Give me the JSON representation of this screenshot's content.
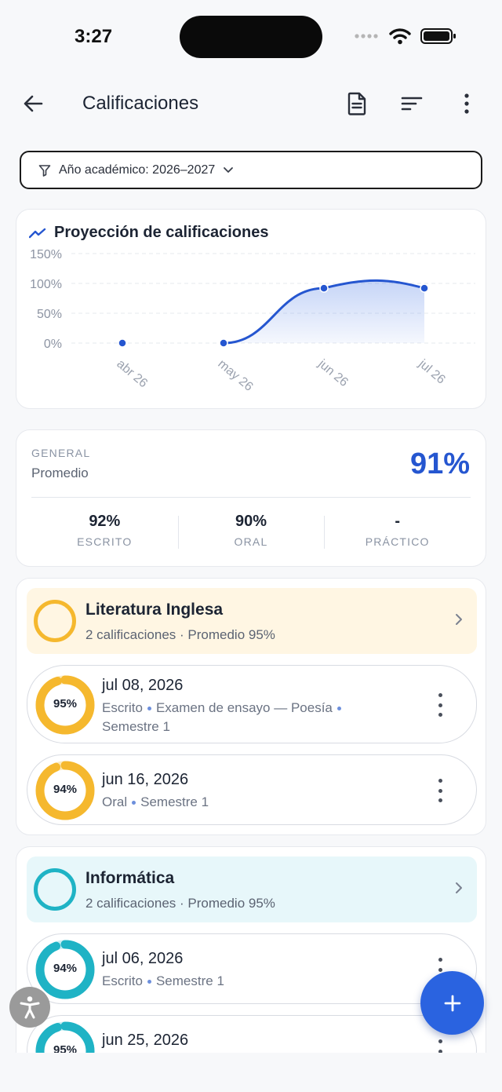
{
  "status": {
    "time": "3:27"
  },
  "app_bar": {
    "title": "Calificaciones"
  },
  "filter": {
    "label": "Año académico: 2026–2027"
  },
  "colors": {
    "accent": "#2556d0",
    "amber": "#f5b82e",
    "teal": "#1fb3c5"
  },
  "chart_data": {
    "type": "area",
    "title": "Proyección de calificaciones",
    "categories": [
      "abr 26",
      "may 26",
      "jun 26",
      "jul 26"
    ],
    "y_ticks": [
      "150%",
      "100%",
      "50%",
      "0%"
    ],
    "ylim": [
      0,
      150
    ],
    "series": [
      {
        "values": [
          0,
          0,
          92,
          92
        ]
      }
    ],
    "grid": true
  },
  "general": {
    "label": "GENERAL",
    "sub": "Promedio",
    "value": "91%",
    "stats": [
      {
        "value": "92%",
        "label": "ESCRITO"
      },
      {
        "value": "90%",
        "label": "ORAL"
      },
      {
        "value": "-",
        "label": "PRÁCTICO"
      }
    ]
  },
  "subjects": [
    {
      "name": "Literatura Inglesa",
      "meta": "2 calificaciones · Promedio 95%",
      "grades": [
        {
          "pct": "95%",
          "percent": 95,
          "date": "jul 08, 2026",
          "type": "Escrito",
          "detail": "Examen de ensayo — Poesía",
          "term": "Semestre 1"
        },
        {
          "pct": "94%",
          "percent": 94,
          "date": "jun 16, 2026",
          "type": "Oral",
          "term": "Semestre 1"
        }
      ]
    },
    {
      "name": "Informática",
      "meta": "2 calificaciones · Promedio 95%",
      "grades": [
        {
          "pct": "94%",
          "percent": 94,
          "date": "jul 06, 2026",
          "type": "Escrito",
          "term": "Semestre 1"
        },
        {
          "pct": "95%",
          "percent": 95,
          "date": "jun 25, 2026"
        }
      ]
    }
  ]
}
